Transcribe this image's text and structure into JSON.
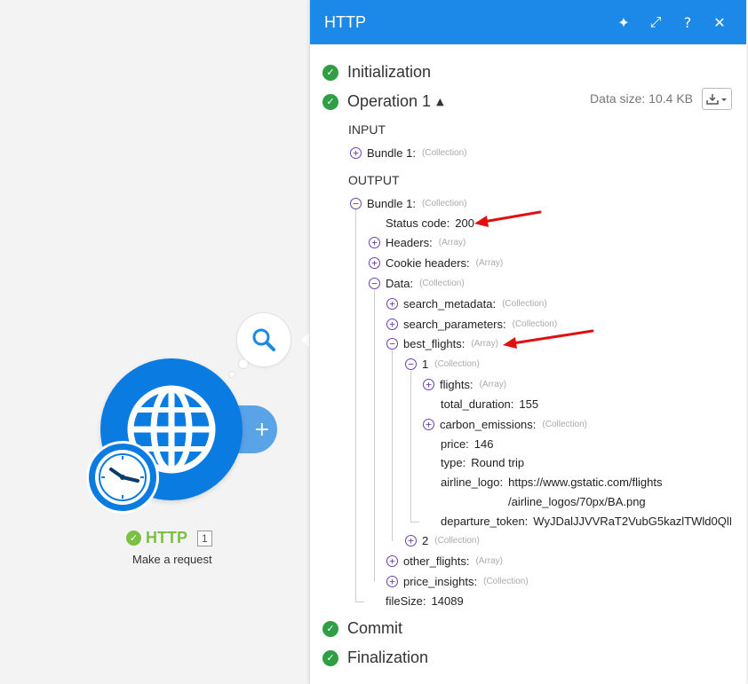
{
  "canvas": {
    "module": {
      "name": "HTTP",
      "count": "1",
      "subtitle": "Make a request",
      "add_glyph": "+"
    }
  },
  "panel": {
    "title": "HTTP",
    "header_icons": [
      "sparkle-icon",
      "expand-icon",
      "help-icon",
      "close-icon"
    ],
    "header_glyphs": {
      "sparkle": "✦",
      "expand": "⤢",
      "help": "?",
      "close": "✕"
    },
    "stages": {
      "initialization": "Initialization",
      "operation": "Operation 1",
      "commit": "Commit",
      "finalization": "Finalization"
    },
    "data_size": "Data size: 10.4 KB",
    "input_label": "INPUT",
    "output_label": "OUTPUT",
    "input": {
      "bundle": {
        "key": "Bundle 1:",
        "type": "(Collection)"
      }
    },
    "output": {
      "bundle": {
        "key": "Bundle 1:",
        "type": "(Collection)"
      },
      "status_code": {
        "key": "Status code:",
        "value": "200"
      },
      "headers": {
        "key": "Headers:",
        "type": "(Array)"
      },
      "cookie_headers": {
        "key": "Cookie headers:",
        "type": "(Array)"
      },
      "data": {
        "key": "Data:",
        "type": "(Collection)"
      },
      "search_metadata": {
        "key": "search_metadata:",
        "type": "(Collection)"
      },
      "search_parameters": {
        "key": "search_parameters:",
        "type": "(Collection)"
      },
      "best_flights": {
        "key": "best_flights:",
        "type": "(Array)"
      },
      "item1": {
        "key": "1",
        "type": "(Collection)"
      },
      "flights": {
        "key": "flights:",
        "type": "(Array)"
      },
      "total_duration": {
        "key": "total_duration:",
        "value": "155"
      },
      "carbon_emissions": {
        "key": "carbon_emissions:",
        "type": "(Collection)"
      },
      "price": {
        "key": "price:",
        "value": "146"
      },
      "type": {
        "key": "type:",
        "value": "Round trip"
      },
      "airline_logo": {
        "key": "airline_logo:",
        "value_line1": "https://www.gstatic.com/flights",
        "value_line2": "/airline_logos/70px/BA.png"
      },
      "departure_token": {
        "key": "departure_token:",
        "value": "WyJDalJJVVRaT2VubG5kazlTWld0QlI"
      },
      "item2": {
        "key": "2",
        "type": "(Collection)"
      },
      "other_flights": {
        "key": "other_flights:",
        "type": "(Array)"
      },
      "price_insights": {
        "key": "price_insights:",
        "type": "(Collection)"
      },
      "file_size": {
        "key": "fileSize:",
        "value": "14089"
      }
    }
  },
  "colors": {
    "header_blue": "#1c89e8",
    "module_blue": "#0a7be0",
    "success_green": "#2f9e44",
    "node_green": "#7bc043",
    "toggle_purple": "#6f3fb1",
    "arrow_red": "#e01010"
  }
}
